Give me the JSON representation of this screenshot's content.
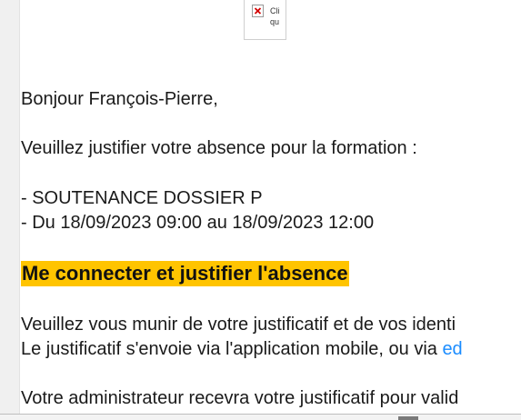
{
  "image_placeholder": {
    "alt_text": "Cliqu",
    "icon": "broken-image-icon"
  },
  "email": {
    "greeting": "Bonjour François-Pierre,",
    "request": "Veuillez justifier votre absence pour la formation :",
    "course": "- SOUTENANCE DOSSIER P",
    "dates": "- Du 18/09/2023 09:00 au 18/09/2023 12:00",
    "cta_label": "Me connecter et justifier l'absence",
    "instructions_1": "Veuillez vous munir de votre justificatif et de vos identi",
    "instructions_2_text": "Le justificatif s'envoie via l'application mobile, ou via ",
    "instructions_2_link": "ed",
    "admin_note": "Votre administrateur recevra votre justificatif pour valid"
  },
  "colors": {
    "cta_highlight": "#ffc400",
    "link": "#1a8cff"
  }
}
